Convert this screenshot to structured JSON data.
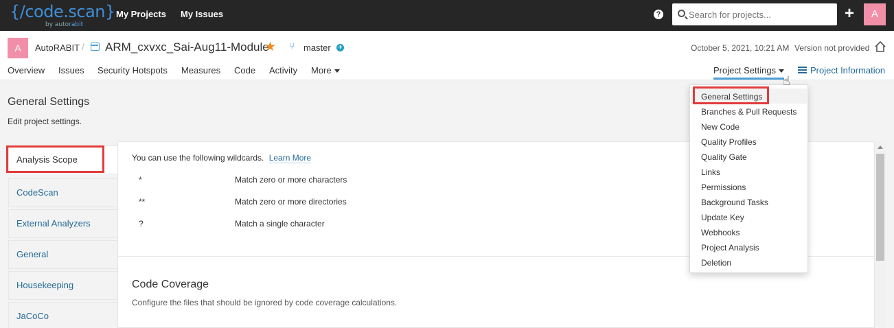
{
  "topbar": {
    "logo_main": "{/code.scan}",
    "logo_sub_by": "by auto",
    "logo_sub_brand": "rabit",
    "nav": [
      "My Projects",
      "My Issues"
    ],
    "help_icon": "?",
    "search_placeholder": "Search for projects...",
    "plus_icon": "+",
    "avatar": "A"
  },
  "project": {
    "avatar": "A",
    "organization": "AutoRABIT",
    "separator": "/",
    "name": "ARM_cxvxc_Sai-Aug11-Module",
    "branch": "master",
    "date": "October 5, 2021, 10:21 AM",
    "version": "Version not provided",
    "tabs": [
      "Overview",
      "Issues",
      "Security Hotspots",
      "Measures",
      "Code",
      "Activity",
      "More"
    ],
    "settings_tab": "Project Settings",
    "info_tab": "Project Information"
  },
  "page": {
    "title": "General Settings",
    "description": "Edit project settings."
  },
  "sidebar": {
    "items": [
      "Analysis Scope",
      "CodeScan",
      "External Analyzers",
      "General",
      "Housekeeping",
      "JaCoCo"
    ]
  },
  "content": {
    "wildcards_intro": "You can use the following wildcards.",
    "learn_more": "Learn More",
    "wildcards": [
      {
        "symbol": "*",
        "description": "Match zero or more characters"
      },
      {
        "symbol": "**",
        "description": "Match zero or more directories"
      },
      {
        "symbol": "?",
        "description": "Match a single character"
      }
    ],
    "coverage_title": "Code Coverage",
    "coverage_description": "Configure the files that should be ignored by code coverage calculations."
  },
  "dropdown": {
    "items": [
      "General Settings",
      "Branches & Pull Requests",
      "New Code",
      "Quality Profiles",
      "Quality Gate",
      "Links",
      "Permissions",
      "Background Tasks",
      "Update Key",
      "Webhooks",
      "Project Analysis",
      "Deletion"
    ]
  },
  "colors": {
    "topbar": "#262626",
    "link": "#236a97",
    "accent": "#4b9fd5",
    "highlight": "#e23b3b",
    "avatar": "#f28fa8",
    "star": "#f28a1e"
  }
}
